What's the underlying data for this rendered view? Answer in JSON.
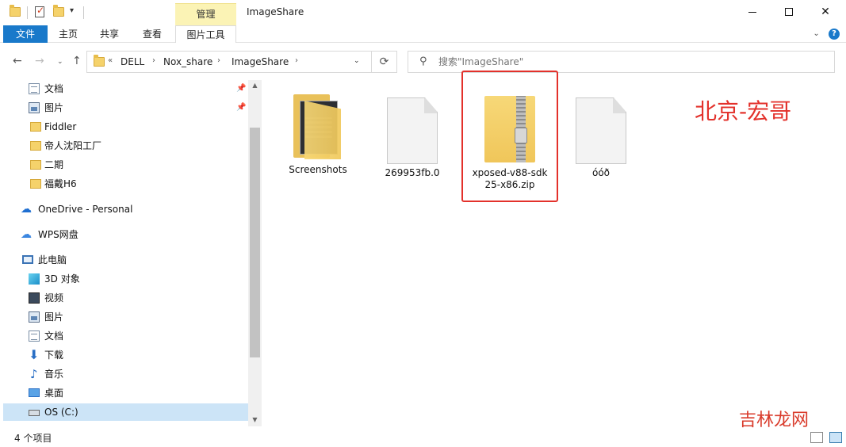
{
  "window": {
    "title": "ImageShare",
    "context_tab": "管理",
    "minimize": "",
    "maximize": "",
    "close": "✕"
  },
  "ribbon": {
    "tabs": [
      "文件",
      "主页",
      "共享",
      "查看",
      "图片工具"
    ]
  },
  "nav": {
    "back": "←",
    "forward": "→",
    "up": "↑",
    "breadcrumb": [
      "DELL",
      "Nox_share",
      "ImageShare"
    ],
    "overflow": "«",
    "refresh": "⟳"
  },
  "search": {
    "placeholder": "搜索\"ImageShare\""
  },
  "sidebar": {
    "items": [
      {
        "label": "文档",
        "icon": "document-icon",
        "pinned": true
      },
      {
        "label": "图片",
        "icon": "pictures-icon",
        "pinned": true
      },
      {
        "label": "Fiddler",
        "icon": "folder-icon"
      },
      {
        "label": "帝人沈阳工厂",
        "icon": "folder-icon"
      },
      {
        "label": "二期",
        "icon": "folder-icon"
      },
      {
        "label": "福戴H6",
        "icon": "folder-icon"
      },
      {
        "label": "OneDrive - Personal",
        "icon": "onedrive-icon"
      },
      {
        "label": "WPS网盘",
        "icon": "wps-cloud-icon"
      },
      {
        "label": "此电脑",
        "icon": "this-pc-icon"
      },
      {
        "label": "3D 对象",
        "icon": "3d-objects-icon"
      },
      {
        "label": "视频",
        "icon": "video-icon"
      },
      {
        "label": "图片",
        "icon": "pictures-icon"
      },
      {
        "label": "文档",
        "icon": "document-icon"
      },
      {
        "label": "下载",
        "icon": "download-icon"
      },
      {
        "label": "音乐",
        "icon": "music-icon"
      },
      {
        "label": "桌面",
        "icon": "desktop-icon"
      },
      {
        "label": "OS (C:)",
        "icon": "disk-icon",
        "selected": true
      }
    ]
  },
  "files": [
    {
      "name": "Screenshots",
      "type": "folder"
    },
    {
      "name": "269953fb.0",
      "type": "blank"
    },
    {
      "name": "xposed-v88-sdk25-x86.zip",
      "type": "zip"
    },
    {
      "name": "óóð",
      "type": "blank"
    }
  ],
  "overlay": {
    "watermark": "北京-宏哥",
    "corner_watermark": "吉林龙网"
  },
  "status": {
    "item_count": "4 个项目"
  },
  "colors": {
    "accent": "#1979ca",
    "highlight": "#e3312b",
    "context_tab": "#fbf3b5"
  }
}
